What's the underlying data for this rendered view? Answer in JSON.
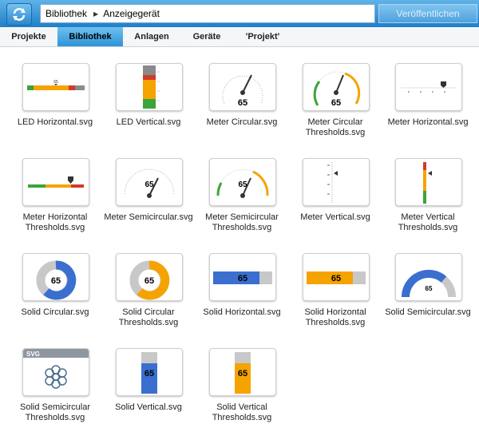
{
  "breadcrumb": {
    "root": "Bibliothek",
    "current": "Anzeigegerät"
  },
  "publish_label": "Veröffentlichen",
  "tabs": [
    {
      "label": "Projekte",
      "active": false
    },
    {
      "label": "Bibliothek",
      "active": true
    },
    {
      "label": "Anlagen",
      "active": false
    },
    {
      "label": "Geräte",
      "active": false
    },
    {
      "label": "'Projekt'",
      "active": false
    }
  ],
  "colors": {
    "accent": "#2e93d8",
    "blue": "#3a6fd0",
    "orange": "#f5a300",
    "green": "#3aa53a",
    "red": "#d23a2a",
    "gray": "#c8c8c8"
  },
  "gauge_value": "65",
  "svg_badge": "SVG",
  "items": [
    {
      "label": "LED Horizontal.svg"
    },
    {
      "label": "LED Vertical.svg"
    },
    {
      "label": "Meter Circular.svg"
    },
    {
      "label": "Meter Circular Thresholds.svg"
    },
    {
      "label": "Meter Horizontal.svg"
    },
    {
      "label": "Meter Horizontal Thresholds.svg"
    },
    {
      "label": "Meter Semicircular.svg"
    },
    {
      "label": "Meter Semicircular Thresholds.svg"
    },
    {
      "label": "Meter Vertical.svg"
    },
    {
      "label": "Meter Vertical Thresholds.svg"
    },
    {
      "label": "Solid Circular.svg"
    },
    {
      "label": "Solid Circular Thresholds.svg"
    },
    {
      "label": "Solid Horizontal.svg"
    },
    {
      "label": "Solid Horizontal Thresholds.svg"
    },
    {
      "label": "Solid Semicircular.svg"
    },
    {
      "label": "Solid Semicircular Thresholds.svg"
    },
    {
      "label": "Solid Vertical.svg"
    },
    {
      "label": "Solid Vertical Thresholds.svg"
    }
  ]
}
